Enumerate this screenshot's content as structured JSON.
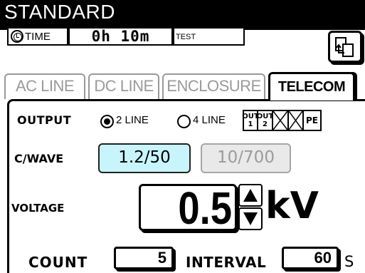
{
  "header": {
    "title": "STANDARD"
  },
  "status": {
    "time_label": "TIME",
    "time_value": "0h 10m",
    "test_label": "TEST",
    "test_value": ""
  },
  "icons": {
    "clock": "clock-icon",
    "copy": "copy-pages-icon",
    "up": "triangle-up-icon",
    "down": "triangle-down-icon"
  },
  "tabs": [
    {
      "label": "AC LINE",
      "active": false
    },
    {
      "label": "DC LINE",
      "active": false
    },
    {
      "label": "ENCLOSURE",
      "active": false
    },
    {
      "label": "TELECOM",
      "active": true
    }
  ],
  "telecom": {
    "output_label": "OUTPUT",
    "output_options": [
      {
        "label": "2 LINE",
        "selected": true
      },
      {
        "label": "4 LINE",
        "selected": false
      }
    ],
    "output_terminals": [
      {
        "top": "OUT",
        "bottom": "1"
      },
      {
        "top": "OUT",
        "bottom": "2"
      },
      {
        "top": "",
        "bottom": ""
      },
      {
        "top": "",
        "bottom": ""
      },
      {
        "top": "PE",
        "bottom": ""
      }
    ],
    "cwave_label": "C/WAVE",
    "waves": [
      {
        "label": "1.2/50",
        "selected": true
      },
      {
        "label": "10/700",
        "selected": false
      }
    ],
    "voltage_label": "VOLTAGE",
    "voltage_value": "0.5",
    "voltage_unit": "kV",
    "count_label": "COUNT",
    "count_value": "5",
    "interval_label": "INTERVAL",
    "interval_value": "60",
    "interval_unit": "S"
  },
  "colors": {
    "selected_button": "#c8f4fb",
    "disabled_button": "#e9e9e9",
    "inactive_tab_text": "#9a9a9a"
  }
}
